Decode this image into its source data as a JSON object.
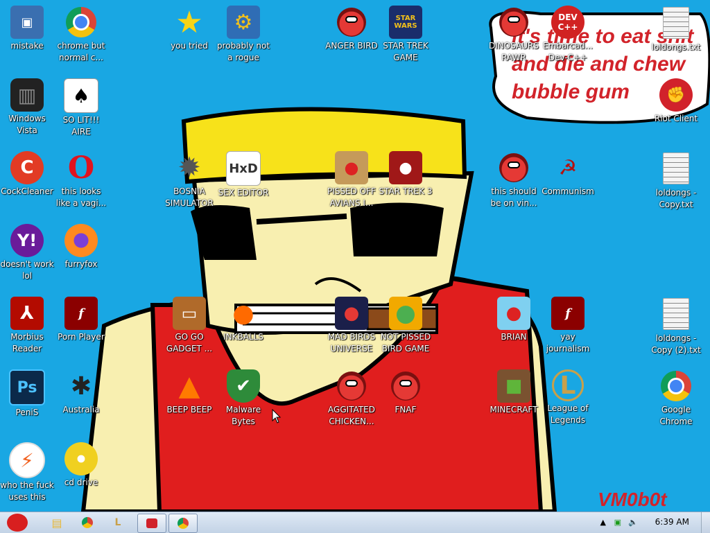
{
  "wallpaper": {
    "speech_bubble": [
      "it's time to eat shit",
      "and die and chew",
      "bubble gum"
    ],
    "signature": "VM0b0t"
  },
  "icons": [
    {
      "label": "mistake",
      "icon": "computer-icon"
    },
    {
      "label": "chrome but normal c...",
      "icon": "chrome-icon"
    },
    {
      "label": "you tried",
      "icon": "star-icon"
    },
    {
      "label": "probably not a rogue",
      "icon": "gears-icon"
    },
    {
      "label": "ANGER BIRD",
      "icon": "angry-bird-icon"
    },
    {
      "label": "STAR TREK GAME",
      "icon": "star-wars-bird-icon"
    },
    {
      "label": "DINOSAURS RAWR",
      "icon": "angry-bird-icon"
    },
    {
      "label": "Embarcad... Dev-C++",
      "icon": "devcpp-icon"
    },
    {
      "label": "loldongs.txt",
      "icon": "text-file-icon"
    },
    {
      "label": "Windows Vista",
      "icon": "trash-icon"
    },
    {
      "label": "SO LIT!!! AIRE",
      "icon": "cards-icon"
    },
    {
      "label": "Riot Client",
      "icon": "riot-icon"
    },
    {
      "label": "CockCleaner",
      "icon": "ccleaner-icon"
    },
    {
      "label": "this looks like a vagi...",
      "icon": "opera-icon"
    },
    {
      "label": "BOSNIA SIMULATOR",
      "icon": "mine-icon"
    },
    {
      "label": "SEX EDITOR",
      "icon": "hxd-icon"
    },
    {
      "label": "PISSED OFF AVIANS I...",
      "icon": "seasons-bird-icon"
    },
    {
      "label": "STAR TREK 3",
      "icon": "star-wars-bird-icon"
    },
    {
      "label": "this should be on vin...",
      "icon": "angry-bird-icon"
    },
    {
      "label": "Communism",
      "icon": "communism-icon"
    },
    {
      "label": "loldongs - Copy.txt",
      "icon": "text-file-icon"
    },
    {
      "label": "doesn't work lol",
      "icon": "yahoo-icon"
    },
    {
      "label": "furryfox",
      "icon": "firefox-icon"
    },
    {
      "label": "Morbius Reader",
      "icon": "acrobat-icon"
    },
    {
      "label": "Porn Player",
      "icon": "flash-icon"
    },
    {
      "label": "GO GO GADGET ...",
      "icon": "briefcase-icon"
    },
    {
      "label": "INKBALLS",
      "icon": "inkball-icon"
    },
    {
      "label": "MAD BIRDS UNIVERSE",
      "icon": "space-bird-icon"
    },
    {
      "label": "NOT PISSED BIRD GAME",
      "icon": "pig-icon"
    },
    {
      "label": "BRIAN",
      "icon": "rio-bird-icon"
    },
    {
      "label": "yay journalism",
      "icon": "flash-icon"
    },
    {
      "label": "loldongs - Copy (2).txt",
      "icon": "text-file-icon"
    },
    {
      "label": "PeniS",
      "icon": "photoshop-icon"
    },
    {
      "label": "Australia",
      "icon": "spider-icon"
    },
    {
      "label": "BEEP BEEP",
      "icon": "vlc-icon"
    },
    {
      "label": "Malware Bytes",
      "icon": "shield-check-icon"
    },
    {
      "label": "AGGITATED CHICKEN...",
      "icon": "angry-bird-icon"
    },
    {
      "label": "FNAF",
      "icon": "angry-bird-icon"
    },
    {
      "label": "MINECRAFT",
      "icon": "minecraft-icon"
    },
    {
      "label": "League of Legends",
      "icon": "league-icon"
    },
    {
      "label": "Google Chrome",
      "icon": "chrome-icon"
    },
    {
      "label": "who the fuck uses this",
      "icon": "flash-circle-icon"
    },
    {
      "label": "cd drive",
      "icon": "cd-icon"
    }
  ],
  "taskbar": {
    "start_icon": "angry-bird-start-icon",
    "pinned": [
      "explorer-icon",
      "chrome-icon",
      "league-icon",
      "riot-icon",
      "chrome-icon"
    ],
    "time": "6:39 AM"
  }
}
